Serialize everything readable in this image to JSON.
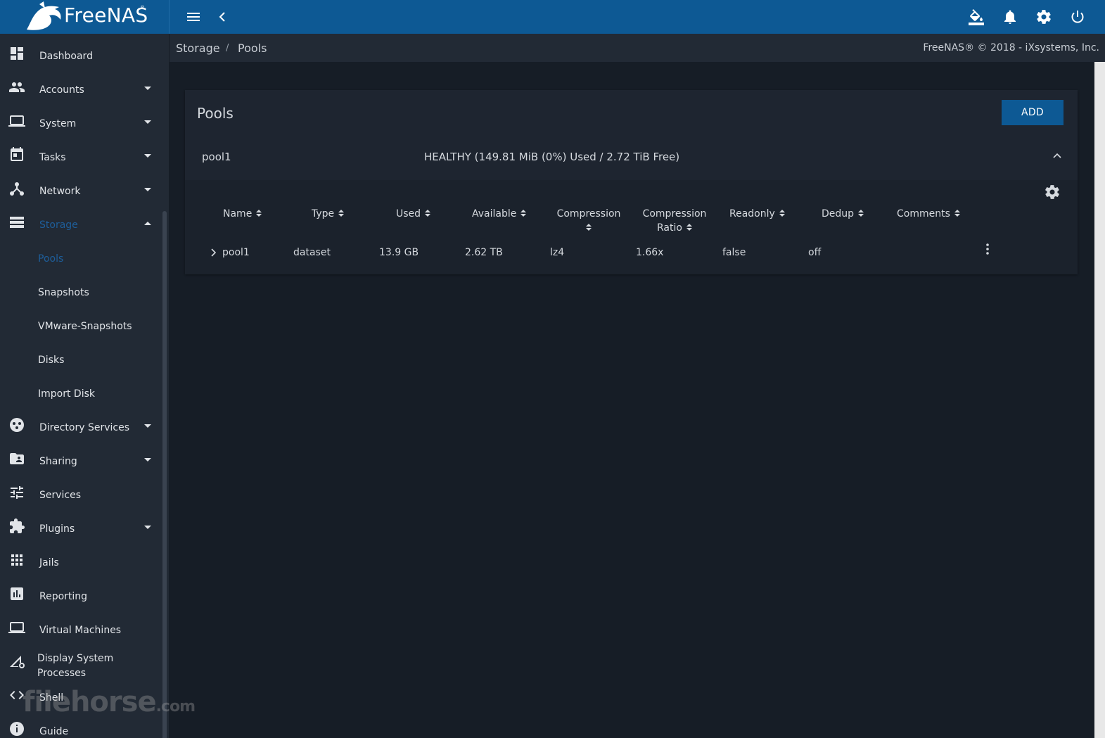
{
  "app": {
    "name": "FreeNAS",
    "trademark": "®"
  },
  "topbar": {
    "icons": [
      "menu-icon",
      "back-chevron-icon",
      "theme-paint-bucket-icon",
      "notifications-bell-icon",
      "settings-gear-icon",
      "power-icon"
    ]
  },
  "breadcrumb": {
    "items": [
      "Storage",
      "Pools"
    ],
    "separator": "/"
  },
  "copyright": "FreeNAS® © 2018 - iXsystems, Inc.",
  "sidebar": {
    "items": [
      {
        "label": "Dashboard",
        "icon": "dashboard-icon",
        "expandable": false
      },
      {
        "label": "Accounts",
        "icon": "accounts-icon",
        "expandable": true
      },
      {
        "label": "System",
        "icon": "laptop-icon",
        "expandable": true
      },
      {
        "label": "Tasks",
        "icon": "calendar-icon",
        "expandable": true
      },
      {
        "label": "Network",
        "icon": "network-icon",
        "expandable": true
      },
      {
        "label": "Storage",
        "icon": "storage-icon",
        "expandable": true,
        "expanded": true,
        "active": true
      },
      {
        "label": "Directory Services",
        "icon": "directory-services-icon",
        "expandable": true
      },
      {
        "label": "Sharing",
        "icon": "sharing-folder-icon",
        "expandable": true
      },
      {
        "label": "Services",
        "icon": "services-tune-icon",
        "expandable": false
      },
      {
        "label": "Plugins",
        "icon": "plugins-puzzle-icon",
        "expandable": true
      },
      {
        "label": "Jails",
        "icon": "jails-grid-icon",
        "expandable": false
      },
      {
        "label": "Reporting",
        "icon": "reporting-chart-icon",
        "expandable": false
      },
      {
        "label": "Virtual Machines",
        "icon": "virtual-machines-icon",
        "expandable": false
      },
      {
        "label": "Display System Processes",
        "line1": "Display System",
        "line2": "Processes",
        "icon": "system-processes-icon",
        "expandable": false
      },
      {
        "label": "Shell",
        "icon": "shell-code-icon",
        "expandable": false
      },
      {
        "label": "Guide",
        "icon": "guide-info-icon",
        "expandable": false
      }
    ],
    "storage_sub": [
      {
        "label": "Pools",
        "active": true
      },
      {
        "label": "Snapshots"
      },
      {
        "label": "VMware-Snapshots"
      },
      {
        "label": "Disks"
      },
      {
        "label": "Import Disk"
      }
    ]
  },
  "watermark": {
    "text": "filehorse",
    "suffix": ".com"
  },
  "main": {
    "card_title": "Pools",
    "add_label": "ADD",
    "pool": {
      "name": "pool1",
      "status": "HEALTHY (149.81 MiB (0%) Used / 2.72 TiB Free)"
    },
    "table": {
      "columns": [
        "Name",
        "Type",
        "Used",
        "Available",
        "Compression",
        "Compression Ratio",
        "Readonly",
        "Dedup",
        "Comments"
      ],
      "column_line1": {
        "compression_ratio": "Compression",
        "compression_ratio_2": "Ratio"
      },
      "rows": [
        {
          "name": "pool1",
          "type": "dataset",
          "used": "13.9 GB",
          "available": "2.62 TB",
          "compression": "lz4",
          "ratio": "1.66x",
          "readonly": "false",
          "dedup": "off",
          "comments": ""
        }
      ]
    }
  },
  "colors": {
    "topbar": "#0d5994",
    "sidebar": "#222a35",
    "background": "#161d26",
    "card": "#1e2530",
    "active": "#1e5e9a"
  }
}
